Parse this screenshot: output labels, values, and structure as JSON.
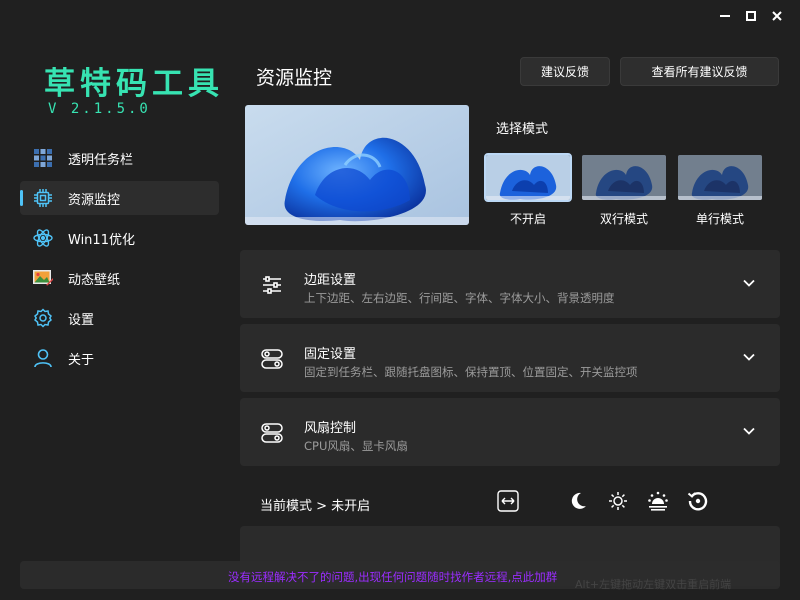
{
  "window": {
    "controls": [
      "minimize-icon",
      "maximize-icon",
      "close-icon"
    ]
  },
  "app": {
    "title": "草特码工具",
    "version": "V 2.1.5.0",
    "accent": "#37e3b2"
  },
  "sidebar": {
    "items": [
      {
        "label": "透明任务栏",
        "icon": "transparent-taskbar-icon"
      },
      {
        "label": "资源监控",
        "icon": "cpu-chip-icon",
        "active": true
      },
      {
        "label": "Win11优化",
        "icon": "atom-icon"
      },
      {
        "label": "动态壁纸",
        "icon": "wallpaper-icon"
      },
      {
        "label": "设置",
        "icon": "gear-icon"
      },
      {
        "label": "关于",
        "icon": "user-icon"
      }
    ]
  },
  "header": {
    "title": "资源监控",
    "feedback_button": "建议反馈",
    "all_feedback_button": "查看所有建议反馈"
  },
  "mode": {
    "title": "选择模式",
    "options": [
      {
        "label": "不开启",
        "selected": true
      },
      {
        "label": "双行模式"
      },
      {
        "label": "单行模式"
      }
    ]
  },
  "cards": [
    {
      "title": "边距设置",
      "subtitle": "上下边距、左右边距、行间距、字体、字体大小、背景透明度",
      "icon": "sliders-icon"
    },
    {
      "title": "固定设置",
      "subtitle": "固定到任务栏、跟随托盘图标、保持置顶、位置固定、开关监控项",
      "icon": "toggle-icon"
    },
    {
      "title": "风扇控制",
      "subtitle": "CPU风扇、显卡风扇",
      "icon": "toggle-icon"
    }
  ],
  "status": {
    "text": "当前模式 > 未开启",
    "icons": [
      "resize-arrows-icon",
      "moon-icon",
      "sun-icon",
      "brightness-icon",
      "reset-icon"
    ]
  },
  "notice": {
    "text": "没有远程解决不了的问题,出现任何问题随时找作者远程,点此加群",
    "ghost": "Alt+左键拖动左键双击重启前端"
  }
}
